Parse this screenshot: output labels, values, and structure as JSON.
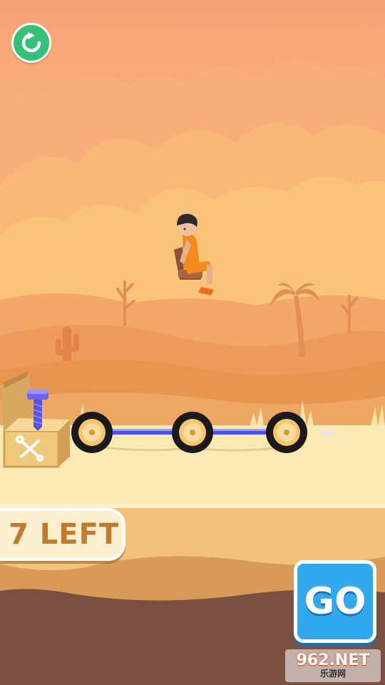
{
  "hud": {
    "remaining_label": "7 LEFT",
    "go_label": "GO"
  },
  "watermark": {
    "main": "962.NET",
    "sub": "乐游网"
  },
  "icons": {
    "restart": "restart-icon",
    "toolbox": "wrench-screwdriver-icon",
    "bolt": "bolt-icon"
  },
  "colors": {
    "sky": "#f6a774",
    "go_button": "#32a8f0",
    "restart_button": "#35c07a",
    "counter_text": "#c07a2c",
    "axle": "#5a5cf0",
    "player_outfit": "#f58a1c"
  }
}
